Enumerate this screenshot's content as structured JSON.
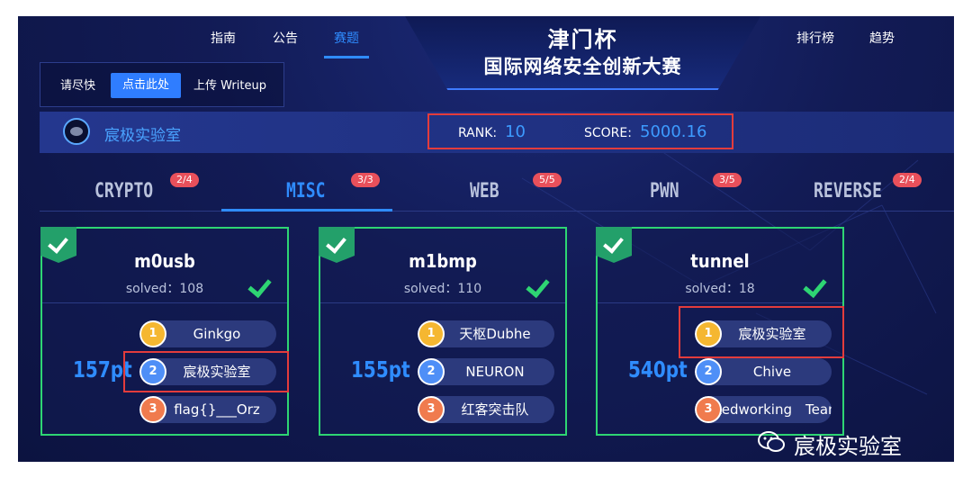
{
  "nav": {
    "left": [
      "指南",
      "公告",
      "赛题"
    ],
    "right": [
      "排行榜",
      "趋势"
    ],
    "active": "赛题"
  },
  "banner": {
    "title1": "津门杯",
    "title2": "国际网络安全创新大赛"
  },
  "hint": {
    "text": "请尽快",
    "button": "点击此处",
    "link": "上传 Writeup"
  },
  "team": {
    "name": "宸极实验室",
    "rank_label": "RANK:",
    "rank": "10",
    "score_label": "SCORE:",
    "score": "5000.16"
  },
  "categories": [
    {
      "label": "CRYPTO",
      "badge": "2/4",
      "active": false
    },
    {
      "label": "MISC",
      "badge": "3/3",
      "active": true
    },
    {
      "label": "WEB",
      "badge": "5/5",
      "active": false
    },
    {
      "label": "PWN",
      "badge": "3/5",
      "active": false
    },
    {
      "label": "REVERSE",
      "badge": "2/4",
      "active": false
    }
  ],
  "challenges": [
    {
      "title": "m0usb",
      "solved": "solved：108",
      "points": "157pt",
      "solvers": [
        "Ginkgo",
        "宸极实验室",
        "flag{}___Orz"
      ]
    },
    {
      "title": "m1bmp",
      "solved": "solved：110",
      "points": "155pt",
      "solvers": [
        "天枢Dubhe",
        "NEURON",
        "红客突击队"
      ]
    },
    {
      "title": "tunnel",
      "solved": "solved：18",
      "points": "540pt",
      "solvers": [
        "宸极实验室",
        "Chive",
        "Redworking　Team"
      ]
    }
  ],
  "watermark": "宸极实验室",
  "colors": {
    "accent": "#2f8cff",
    "solved": "#2ed573",
    "highlight": "#e33c3c",
    "badge": "#e8505b"
  }
}
